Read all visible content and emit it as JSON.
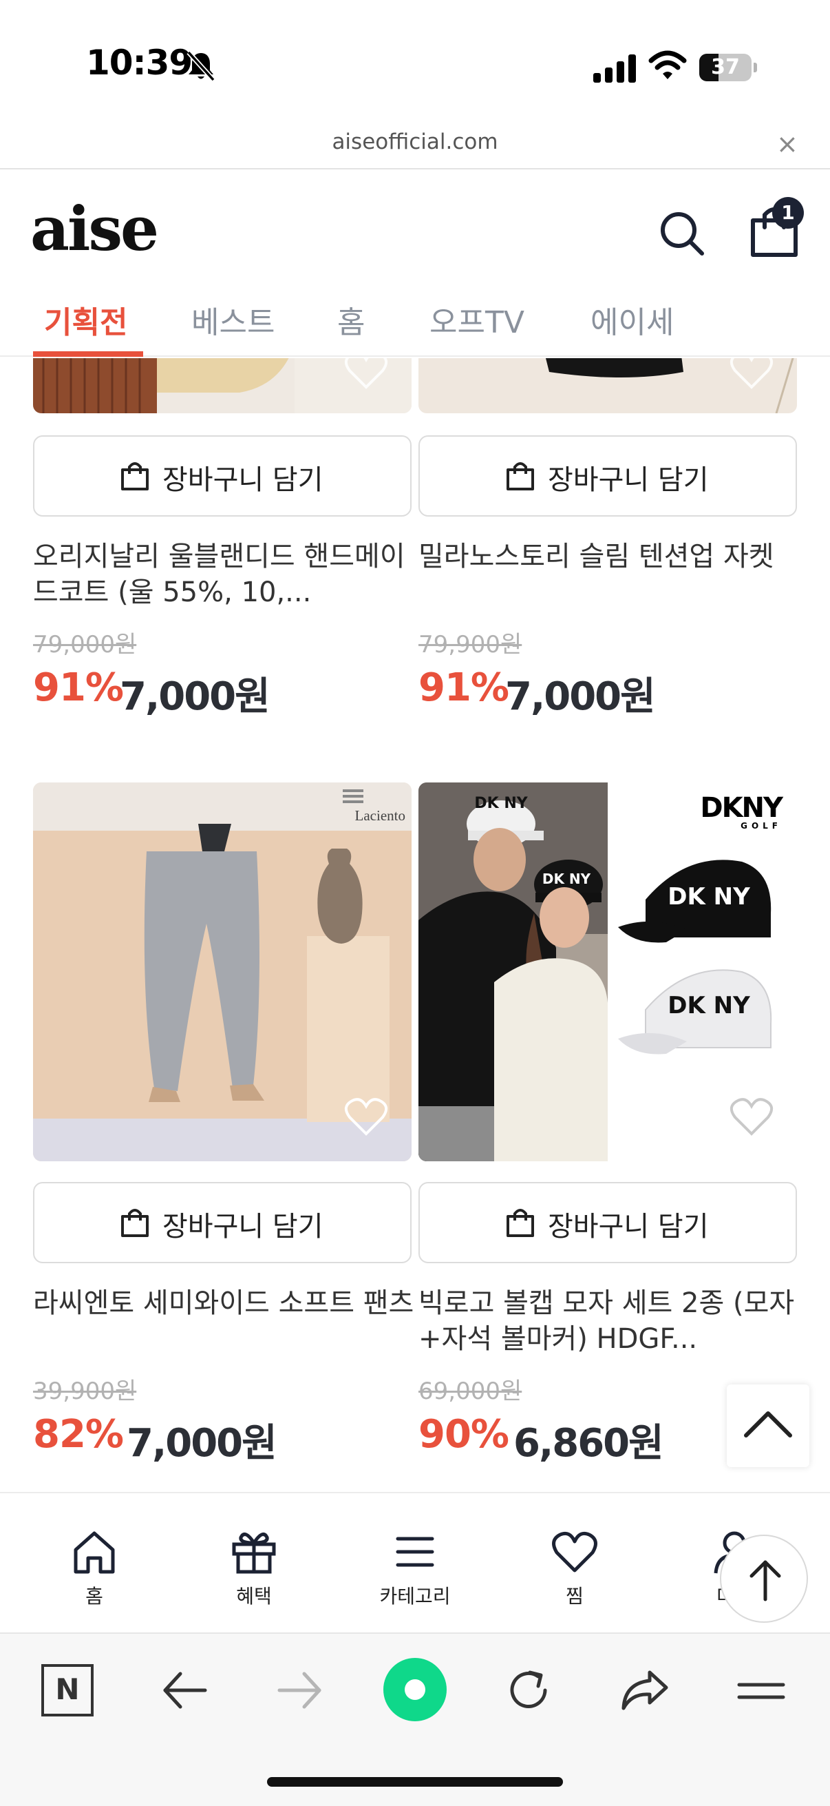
{
  "status_bar": {
    "time": "10:39",
    "battery_percent": 37,
    "battery_label": "37"
  },
  "url_bar": {
    "domain": "aiseofficial.com",
    "close_label": "×"
  },
  "header": {
    "logo": "aise",
    "cart_count": "1",
    "tabs": [
      {
        "label": "기획전",
        "active": true
      },
      {
        "label": "베스트",
        "active": false
      },
      {
        "label": "홈",
        "active": false
      },
      {
        "label": "오프TV",
        "active": false
      },
      {
        "label": "에이세",
        "active": false
      }
    ]
  },
  "products": [
    {
      "add_to_cart": "장바구니 담기",
      "name": "오리지날리 울블랜디드 핸드메이드코트 (울 55%, 10,...",
      "original_price": "79,000원",
      "discount": "91%",
      "price": "7,000원"
    },
    {
      "add_to_cart": "장바구니 담기",
      "name": "밀라노스토리 슬림 텐션업 자켓",
      "original_price": "79,900원",
      "discount": "91%",
      "price": "7,000원"
    },
    {
      "add_to_cart": "장바구니 담기",
      "name": "라씨엔토 세미와이드 소프트 팬츠",
      "original_price": "39,900원",
      "discount": "82%",
      "price": "7,000원",
      "image_brand": "Laciento"
    },
    {
      "add_to_cart": "장바구니 담기",
      "name": "빅로고 볼캡 모자 세트 2종 (모자+자석 볼마커) HDGF...",
      "original_price": "69,000원",
      "discount": "90%",
      "price": "6,860원",
      "image_brand": "DKNY",
      "image_brand_sub": "GOLF",
      "cap_logo": "DK NY"
    }
  ],
  "bottom_nav": [
    {
      "label": "홈",
      "icon": "home-icon"
    },
    {
      "label": "혜택",
      "icon": "gift-icon"
    },
    {
      "label": "카테고리",
      "icon": "menu-icon"
    },
    {
      "label": "찜",
      "icon": "heart-icon"
    },
    {
      "label": "마이",
      "icon": "user-icon"
    }
  ],
  "browser_toolbar": {
    "naver_label": "N"
  },
  "colors": {
    "accent": "#e8513c",
    "price_text": "#2c2f36",
    "tab_inactive": "#8a919c",
    "browser_green": "#0fd88a"
  }
}
